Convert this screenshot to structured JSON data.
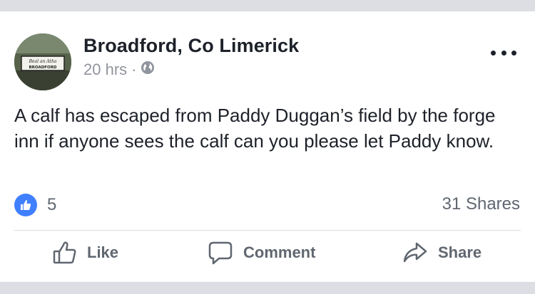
{
  "post": {
    "page_name": "Broadford, Co Limerick",
    "time": "20 hrs",
    "separator": "·",
    "privacy_icon": "globe-icon",
    "avatar_sign_text": [
      "Beal an Atha",
      "BROADFORD"
    ],
    "body": "A calf has escaped from Paddy Duggan’s field by the forge inn if anyone sees the calf can you please let Paddy know.",
    "like_count": "5",
    "shares": "31 Shares"
  },
  "actions": {
    "like": "Like",
    "comment": "Comment",
    "share": "Share"
  },
  "colors": {
    "like_blue": "#4080ff",
    "text": "#1d2129",
    "secondary": "#606770",
    "meta": "#90949c"
  }
}
